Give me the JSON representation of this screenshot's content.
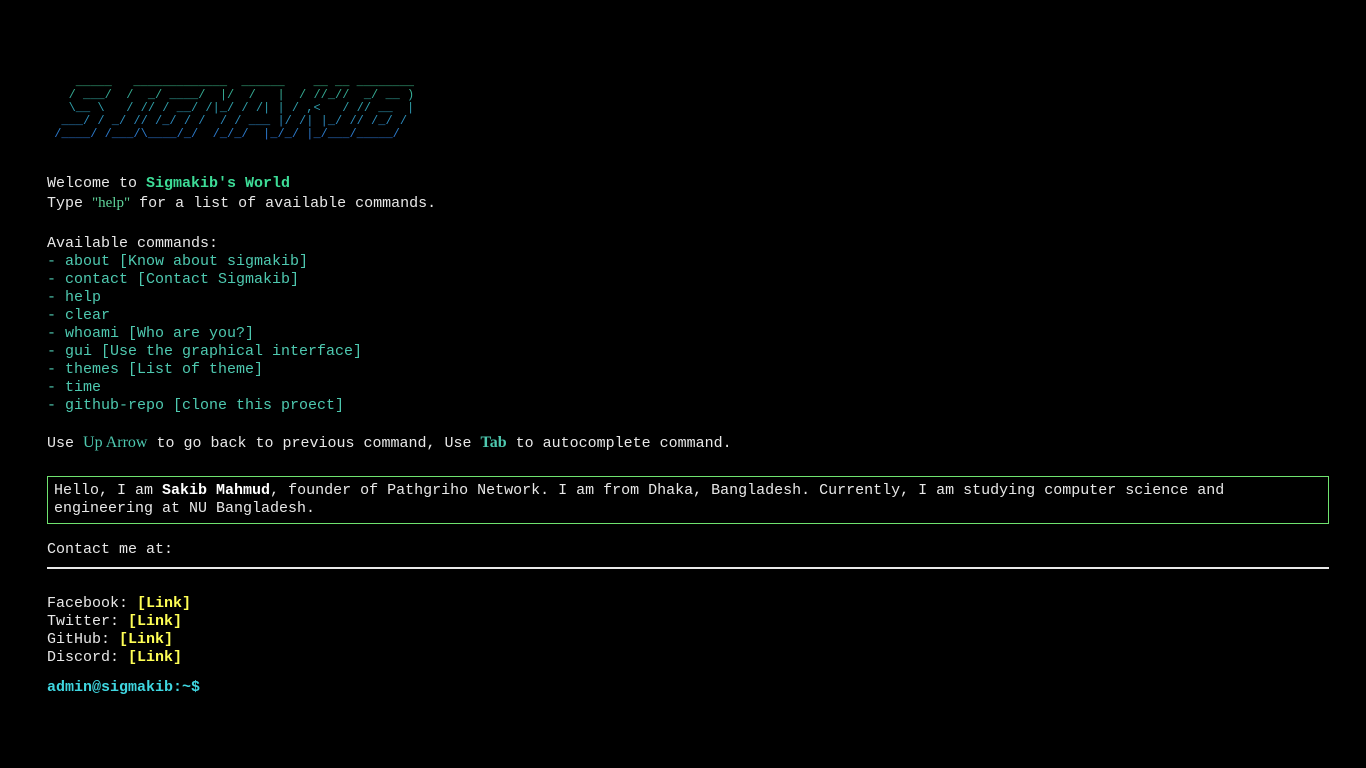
{
  "banner": {
    "art": "    _____   _____________  ______    __ __ ________\n   / ___/  /  _/ ____/  |/  /   |  / //_//  _/ __ )\n   \\__ \\   / // / __/ /|_/ / /| | / ,<   / // __  |\n  ___/ / _/ // /_/ / /  / / ___ |/ /| |_/ // /_/ /\n /____/ /___/\\____/_/  /_/_/  |_/_/ |_/___/_____/",
    "gradient": [
      "#3fbf73",
      "#2fa0b3",
      "#2b6fd6"
    ]
  },
  "welcome": {
    "prefix": "Welcome to ",
    "name": "Sigmakib's World",
    "type_prefix": "Type ",
    "help_word": "\"help\"",
    "type_suffix": " for a list of available commands."
  },
  "commands": {
    "heading": "Available commands:",
    "items": [
      "- about [Know about sigmakib]",
      "- contact [Contact Sigmakib]",
      "- help",
      "- clear",
      "- whoami [Who are you?]",
      "- gui [Use the graphical interface]",
      "- themes [List of theme]",
      "- time",
      "- github-repo [clone this proect]"
    ]
  },
  "hint": {
    "use1": "Use ",
    "key1": "Up Arrow",
    "mid": " to go back to previous command, Use ",
    "key2": "Tab",
    "end": " to autocomplete command."
  },
  "about": {
    "intro": "Hello, I am ",
    "name": "Sakib Mahmud",
    "rest": ", founder of Pathgriho Network. I am from Dhaka, Bangladesh. Currently, I am studying computer science and engineering at NU Bangladesh."
  },
  "contact": {
    "heading": "Contact me at:",
    "links": [
      {
        "label": "Facebook: ",
        "link": "[Link]"
      },
      {
        "label": "Twitter: ",
        "link": "[Link]"
      },
      {
        "label": "GitHub: ",
        "link": "[Link]"
      },
      {
        "label": "Discord: ",
        "link": "[Link]"
      }
    ]
  },
  "prompt": {
    "text": "admin@sigmakib:~$"
  },
  "colors": {
    "background": "#000000",
    "text": "#e8e8e8",
    "accent_green": "#3ddc97",
    "command": "#4ec9b0",
    "link": "#ffff55",
    "prompt": "#3fd6e0",
    "box_border": "#6fe36f"
  }
}
